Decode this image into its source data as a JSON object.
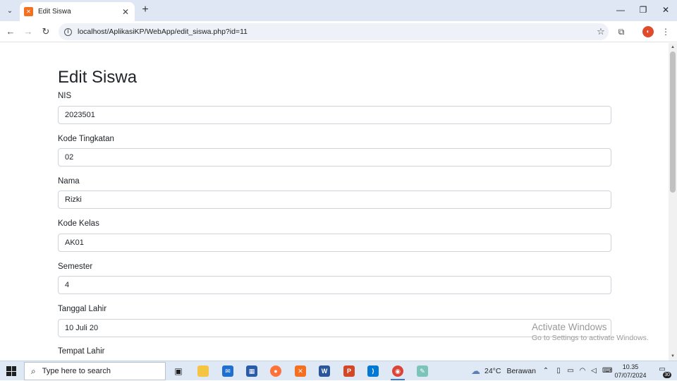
{
  "browser": {
    "tab_title": "Edit Siswa",
    "url": "localhost/AplikasiKP/WebApp/edit_siswa.php?id=11"
  },
  "page": {
    "title": "Edit Siswa",
    "fields": [
      {
        "label": "NIS",
        "value": "2023501"
      },
      {
        "label": "Kode Tingkatan",
        "value": "02"
      },
      {
        "label": "Nama",
        "value": "Rizki"
      },
      {
        "label": "Kode Kelas",
        "value": "AK01"
      },
      {
        "label": "Semester",
        "value": "4"
      },
      {
        "label": "Tanggal Lahir",
        "value": "10 Juli 20"
      },
      {
        "label": "Tempat Lahir",
        "value": ""
      }
    ]
  },
  "watermark": {
    "title": "Activate Windows",
    "subtitle": "Go to Settings to activate Windows."
  },
  "taskbar": {
    "search_placeholder": "Type here to search",
    "weather_temp": "24°C",
    "weather_text": "Berawan",
    "time": "10.35",
    "date": "07/07/2024",
    "notification_count": "30"
  },
  "colors": {
    "tab_bar_bg": "#dfe7f5",
    "omnibox_bg": "#eef2f8",
    "input_border": "#ced4da",
    "taskbar_bg": "#dfe9f5"
  }
}
